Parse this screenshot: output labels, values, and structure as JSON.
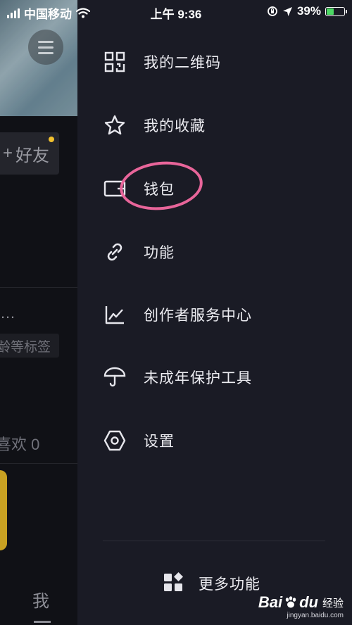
{
  "status_bar": {
    "carrier": "中国移动",
    "time": "上午 9:36",
    "battery_percent": "39%",
    "battery_level": 0.39,
    "battery_color": "#4cd964",
    "icons": [
      "signal-icon",
      "wifi-icon",
      "orientation-lock-icon",
      "location-icon",
      "battery-icon"
    ]
  },
  "background_page": {
    "add_friend_label": "好友",
    "ellipsis": "…",
    "tag_text": "龄等标签",
    "likes_text": "喜欢 0",
    "tab_me": "我",
    "badge_color": "#f2c12e"
  },
  "drawer": {
    "items": [
      {
        "label": "我的二维码",
        "icon": "qr-code-icon"
      },
      {
        "label": "我的收藏",
        "icon": "star-icon"
      },
      {
        "label": "钱包",
        "icon": "wallet-icon"
      },
      {
        "label": "功能",
        "icon": "link-icon"
      },
      {
        "label": "创作者服务中心",
        "icon": "chart-icon"
      },
      {
        "label": "未成年保护工具",
        "icon": "umbrella-icon"
      },
      {
        "label": "设置",
        "icon": "hexagon-settings-icon"
      }
    ],
    "more_label": "更多功能",
    "more_icon": "grid-apps-icon",
    "highlight_color": "#e8659a"
  },
  "watermark": {
    "brand": "Bai",
    "brand_suffix": "du",
    "brand_cn": "经验",
    "url": "jingyan.baidu.com"
  }
}
